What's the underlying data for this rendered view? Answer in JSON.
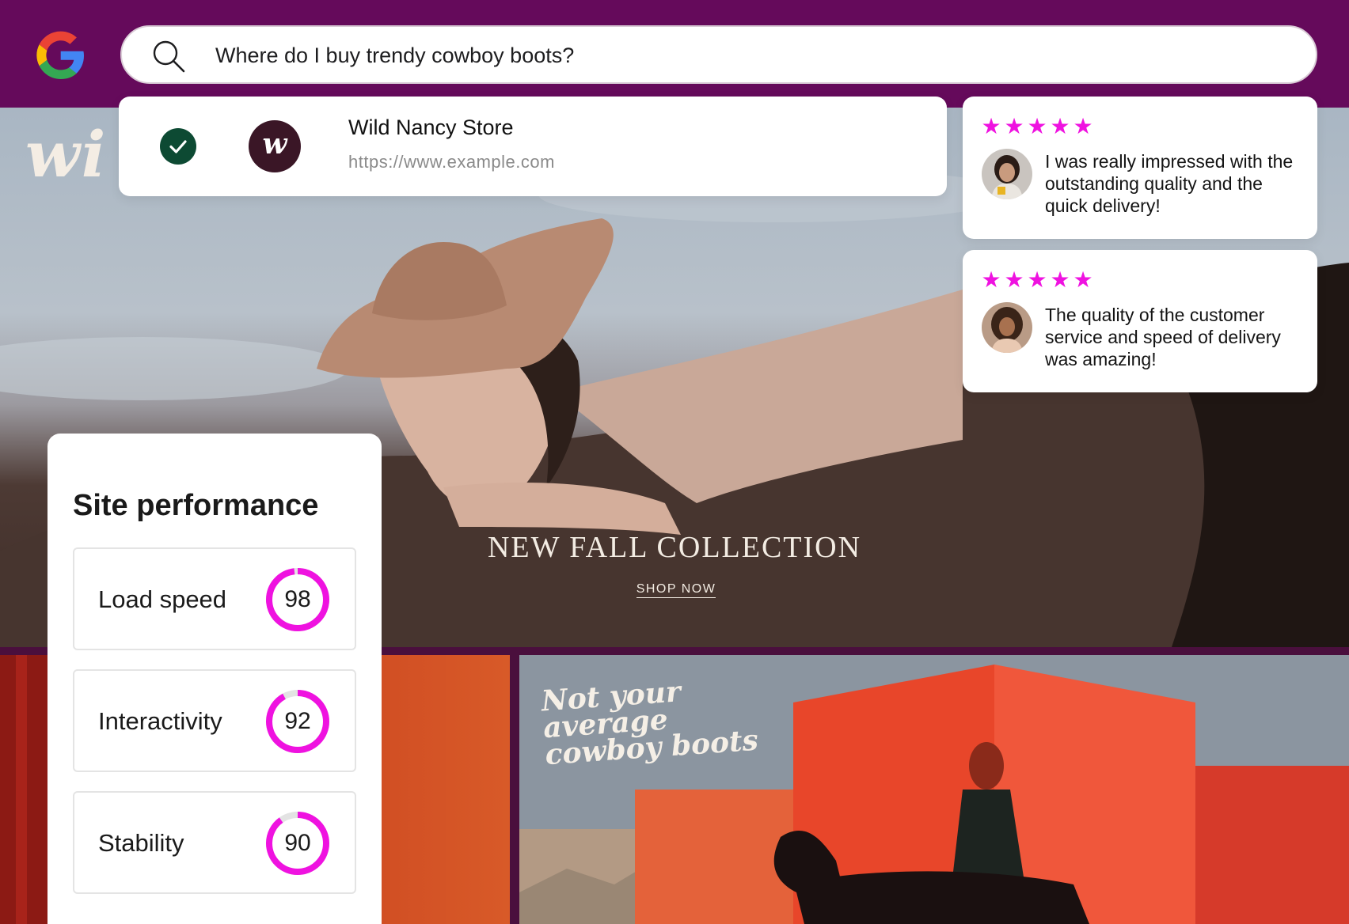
{
  "search": {
    "query": "Where do I buy trendy cowboy boots?"
  },
  "result": {
    "store_name": "Wild Nancy Store",
    "url": "https://www.example.com",
    "logo_letter": "w"
  },
  "reviews": [
    {
      "rating": 5,
      "text": "I was really impressed with the outstanding quality and the quick delivery!"
    },
    {
      "rating": 5,
      "text": "The quality of the customer service and speed of delivery was amazing!"
    }
  ],
  "hero": {
    "script_text": "wi",
    "title": "NEW FALL COLLECTION",
    "cta": "SHOP NOW"
  },
  "promo": {
    "script_lines": [
      "Not your",
      "average",
      "cowboy boots"
    ]
  },
  "site_performance": {
    "title": "Site performance",
    "metrics": [
      {
        "label": "Load speed",
        "score": 98
      },
      {
        "label": "Interactivity",
        "score": 92
      },
      {
        "label": "Stability",
        "score": 90
      }
    ]
  },
  "colors": {
    "top_bar": "#650a5b",
    "star": "#ef12e0",
    "gauge": "#ef12e0",
    "gauge_track": "#e3e3e3",
    "check": "#0d4a33",
    "brand_logo_bg": "#3a1626"
  },
  "icons": {
    "search": "search-icon",
    "google": "google-logo",
    "verified": "check-icon",
    "star": "star-icon"
  }
}
